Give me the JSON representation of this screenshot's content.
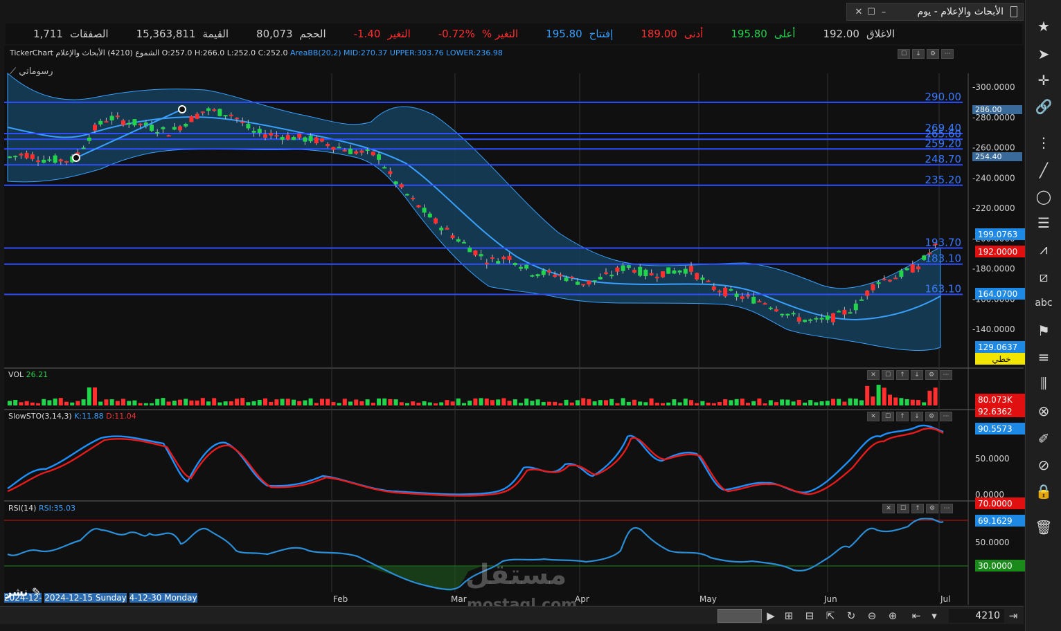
{
  "window": {
    "title": "الأبحاث والإعلام - يوم",
    "symbol": "4210"
  },
  "quote": {
    "close_label": "الاغلاق",
    "close": "192.00",
    "high_label": "أعلى",
    "high": "195.80",
    "low_label": "أدنى",
    "low": "189.00",
    "open_label": "إفتتاح",
    "open": "195.80",
    "change_pct_label": "التغير %",
    "change_pct": "-0.72%",
    "change_label": "التغير",
    "change": "-1.40",
    "volume_label": "الحجم",
    "volume": "80,073",
    "value_label": "القيمة",
    "value": "15,363,811",
    "trades_label": "الصفقات",
    "trades": "1,711"
  },
  "main_panel": {
    "header_prefix": "TickerChart",
    "header_name": "الشموع (4210) الأبحاث والإعلام",
    "ohlc": "O:257.0  H:266.0  L:252.0  C:252.0",
    "bb_name": "AreaBB(20,2)",
    "bb_mid": "MID:270.37",
    "bb_upper": "UPPER:303.76",
    "bb_lower": "LOWER:236.98",
    "drawing_label": "رسوماتي",
    "hlines": [
      "290.00",
      "269.40",
      "265.60",
      "259.20",
      "248.70",
      "235.20",
      "193.70",
      "183.10",
      "163.10"
    ],
    "axis": [
      "300.0000",
      "280.0000",
      "260.0000",
      "240.0000",
      "220.0000",
      "200.0000",
      "180.0000",
      "160.0000",
      "140.0000"
    ],
    "tags": {
      "t286": "286.00",
      "t254": "254.40",
      "t199": "199.0763",
      "t192": "192.0000",
      "t164": "164.0700",
      "t129": "129.0637",
      "linear": "خطي"
    }
  },
  "vol_panel": {
    "name": "VOL",
    "value": "26.21",
    "tag1": "80.073K",
    "tag2": "92.6362"
  },
  "sto_panel": {
    "name": "SlowSTO(3,14,3)",
    "k": "K:11.88",
    "d": "D:11.04",
    "axis_50": "50.0000",
    "axis_0": "0.0000",
    "tag": "90.5573"
  },
  "rsi_panel": {
    "name": "RSI(14)",
    "value": "RSI:35.03",
    "axis_50": "50.0000",
    "tag70": "70.0000",
    "tag_cur": "69.1629",
    "tag30": "30.0000"
  },
  "xaxis": {
    "labels": [
      "Feb",
      "Mar",
      "Apr",
      "May",
      "Jun",
      "Jul"
    ],
    "range_text1": "2024-12-",
    "range_text2": "2024-12-15 Sunday",
    "range_text3": "4-12-30 Monday"
  },
  "bottom": {
    "publish": "نشر"
  },
  "watermark": {
    "ar": "مستقل",
    "en": "mostaql.com"
  },
  "colors": {
    "up": "#22d44b",
    "down": "#ff2f2f",
    "hline": "#2f4fff",
    "band": "#1a4a66",
    "mid": "#3aa0ff"
  }
}
